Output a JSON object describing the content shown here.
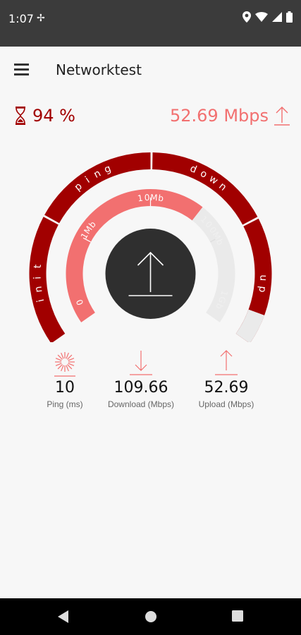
{
  "status": {
    "time": "1:07"
  },
  "app": {
    "title": "Networktest"
  },
  "progress": {
    "text": "94 %",
    "fraction": 0.94
  },
  "current_speed": {
    "text": "52.69 Mbps"
  },
  "gauge": {
    "phases": [
      "init",
      "ping",
      "down",
      "up"
    ],
    "scale_labels": [
      "0",
      "1Mb",
      "10Mb",
      "100Mb",
      "1Gb"
    ],
    "needle_value": "52.69 Mbps"
  },
  "stats": [
    {
      "value": "10",
      "label": "Ping (ms)",
      "icon": "ping-burst-icon"
    },
    {
      "value": "109.66",
      "label": "Download (Mbps)",
      "icon": "download-arrow-icon"
    },
    {
      "value": "52.69",
      "label": "Upload (Mbps)",
      "icon": "upload-arrow-icon"
    }
  ],
  "colors": {
    "dark_red": "#a10000",
    "light_red": "#f27070",
    "gray": "#eaeaea",
    "dark_circle": "#2f2f2f"
  }
}
